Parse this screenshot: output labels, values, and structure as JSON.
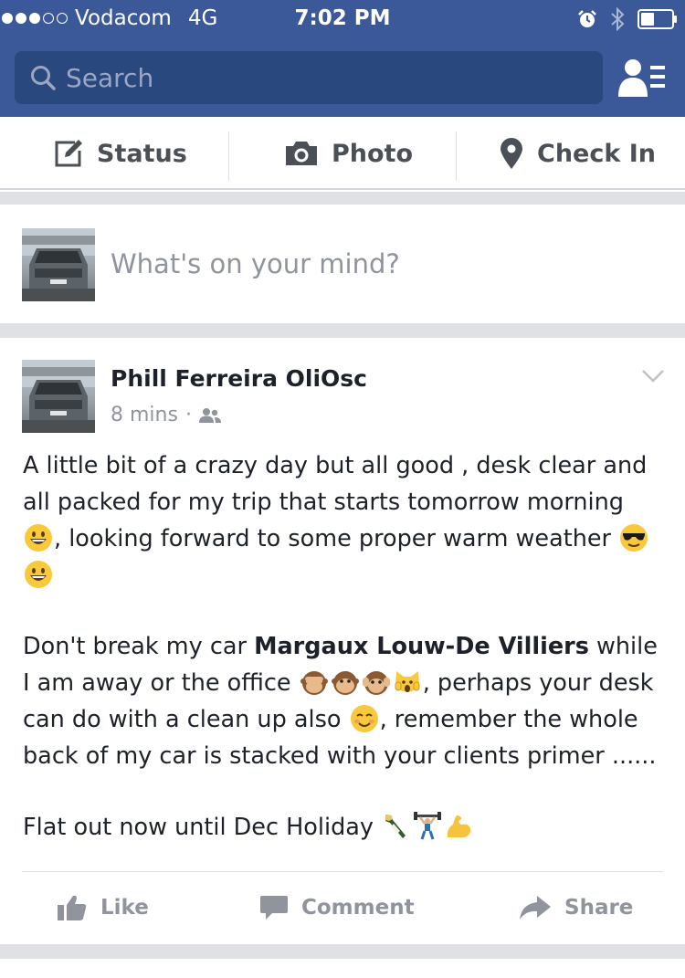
{
  "status_bar": {
    "carrier": "Vodacom",
    "network": "4G",
    "time": "7:02 PM",
    "signal_bars_filled": 3,
    "icons": [
      "alarm-icon",
      "bluetooth-icon",
      "battery-icon"
    ]
  },
  "header": {
    "search_placeholder": "Search",
    "icons": [
      "search-icon",
      "friend-requests-icon"
    ]
  },
  "composer": {
    "status_label": "Status",
    "photo_label": "Photo",
    "checkin_label": "Check In",
    "prompt": "What's on your mind?"
  },
  "post": {
    "author": "Phill Ferreira OliOsc",
    "time": "8 mins",
    "separator": "·",
    "audience_icon": "friends-icon",
    "p1_a": "A little bit of a crazy day but all good , desk clear and all packed for my trip that starts tomorrow morning ",
    "p1_b": ", looking forward to some proper warm weather ",
    "p2_a": "Don't break my car ",
    "p2_mention": "Margaux Louw-De Villiers",
    "p2_b": " while I am away or the office ",
    "p2_c": ", perhaps your desk can do with a clean up also ",
    "p2_d": ", remember the whole back of my car is stacked with your clients primer ......",
    "p3": "Flat out now until Dec Holiday ",
    "emojis": [
      "grinning",
      "sunglasses",
      "grinning",
      "see-no-evil-monkey",
      "monkey-face",
      "hear-no-evil-monkey",
      "screaming-cat",
      "smiling-blush",
      "champagne",
      "weightlifter",
      "flexed-biceps"
    ]
  },
  "actions": {
    "like_label": "Like",
    "comment_label": "Comment",
    "share_label": "Share"
  },
  "colors": {
    "brand_blue": "#3b5998",
    "search_bg": "#29487d",
    "muted_text": "#90949c",
    "divider": "#dfe1e4"
  }
}
